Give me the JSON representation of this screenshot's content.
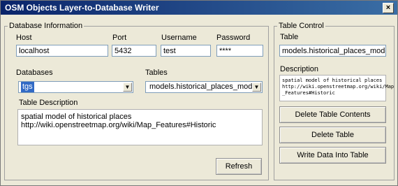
{
  "window": {
    "title": "OSM Objects Layer-to-Database Writer",
    "close_glyph": "×"
  },
  "db_info": {
    "legend": "Database Information",
    "host_label": "Host",
    "host_value": "localhost",
    "port_label": "Port",
    "port_value": "5432",
    "username_label": "Username",
    "username_value": "test",
    "password_label": "Password",
    "password_value": "****",
    "databases_label": "Databases",
    "databases_selected": "tgs",
    "tables_label": "Tables",
    "tables_selected": "models.historical_places_model",
    "table_desc_label": "Table Description",
    "table_desc_value": "spatial model of historical places\nhttp://wiki.openstreetmap.org/wiki/Map_Features#Historic",
    "refresh_label": "Refresh"
  },
  "table_control": {
    "legend": "Table Control",
    "table_label": "Table",
    "table_value": "models.historical_places_model",
    "description_label": "Description",
    "description_value": "spatial model of historical places\nhttp://wiki.openstreetmap.org/wiki/Map\n_Features#Historic",
    "delete_contents_label": "Delete Table Contents",
    "delete_table_label": "Delete Table",
    "write_data_label": "Write Data Into Table"
  },
  "colors": {
    "titlebar_start": "#0a246a",
    "titlebar_end": "#3a6ea5",
    "selection": "#316ac5",
    "window_bg": "#ece9d8"
  },
  "icons": {
    "dropdown": "chevron-down-icon",
    "close": "close-icon"
  }
}
